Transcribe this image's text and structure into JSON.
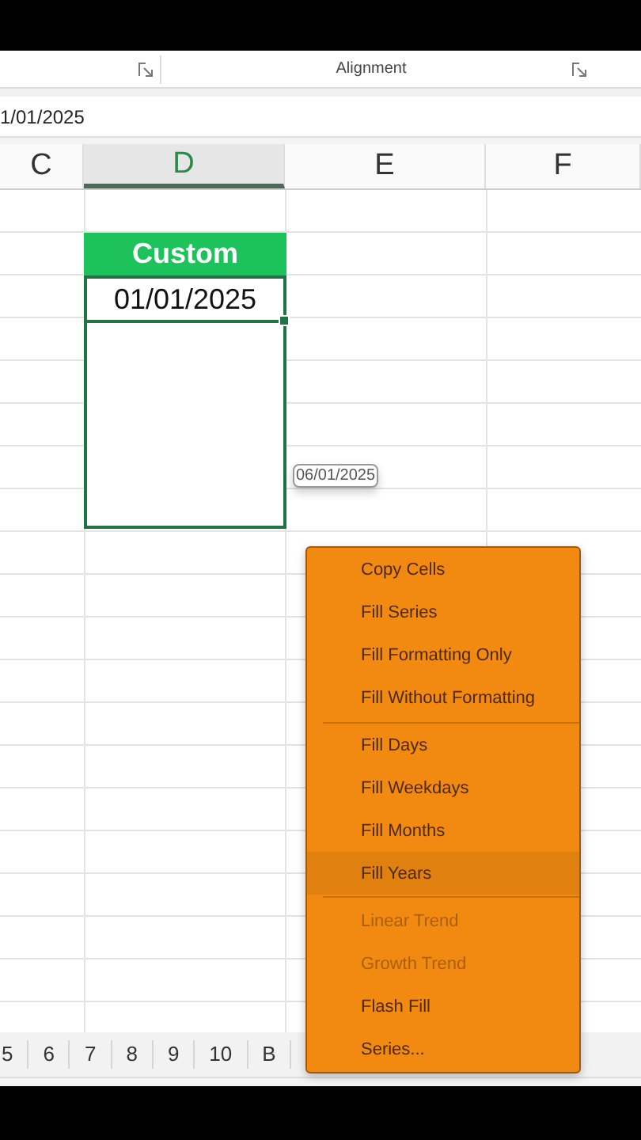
{
  "ribbon": {
    "group_label": "Alignment"
  },
  "formula_bar": {
    "value": "1/01/2025"
  },
  "columns": [
    {
      "label": "C",
      "selected": false
    },
    {
      "label": "D",
      "selected": true
    },
    {
      "label": "E",
      "selected": false
    },
    {
      "label": "F",
      "selected": false
    }
  ],
  "cells": {
    "header": "Custom",
    "date": "01/01/2025"
  },
  "fill_tooltip": "06/01/2025",
  "context_menu": [
    {
      "label": "Copy Cells",
      "selected": false,
      "disabled": false
    },
    {
      "label": "Fill Series",
      "selected": false,
      "disabled": false
    },
    {
      "label": "Fill Formatting Only",
      "selected": false,
      "disabled": false
    },
    {
      "label": "Fill Without Formatting",
      "selected": false,
      "disabled": false,
      "separator_after": true
    },
    {
      "label": "Fill Days",
      "selected": false,
      "disabled": false
    },
    {
      "label": "Fill Weekdays",
      "selected": false,
      "disabled": false
    },
    {
      "label": "Fill Months",
      "selected": false,
      "disabled": false
    },
    {
      "label": "Fill Years",
      "selected": true,
      "disabled": false,
      "separator_after": true
    },
    {
      "label": "Linear Trend",
      "selected": false,
      "disabled": true
    },
    {
      "label": "Growth Trend",
      "selected": false,
      "disabled": true
    },
    {
      "label": "Flash Fill",
      "selected": false,
      "disabled": false
    },
    {
      "label": "Series...",
      "selected": false,
      "disabled": false
    }
  ],
  "sheet_tabs": [
    {
      "label": "5"
    },
    {
      "label": "6"
    },
    {
      "label": "7"
    },
    {
      "label": "8"
    },
    {
      "label": "9"
    },
    {
      "label": "10"
    },
    {
      "label": "B"
    }
  ]
}
